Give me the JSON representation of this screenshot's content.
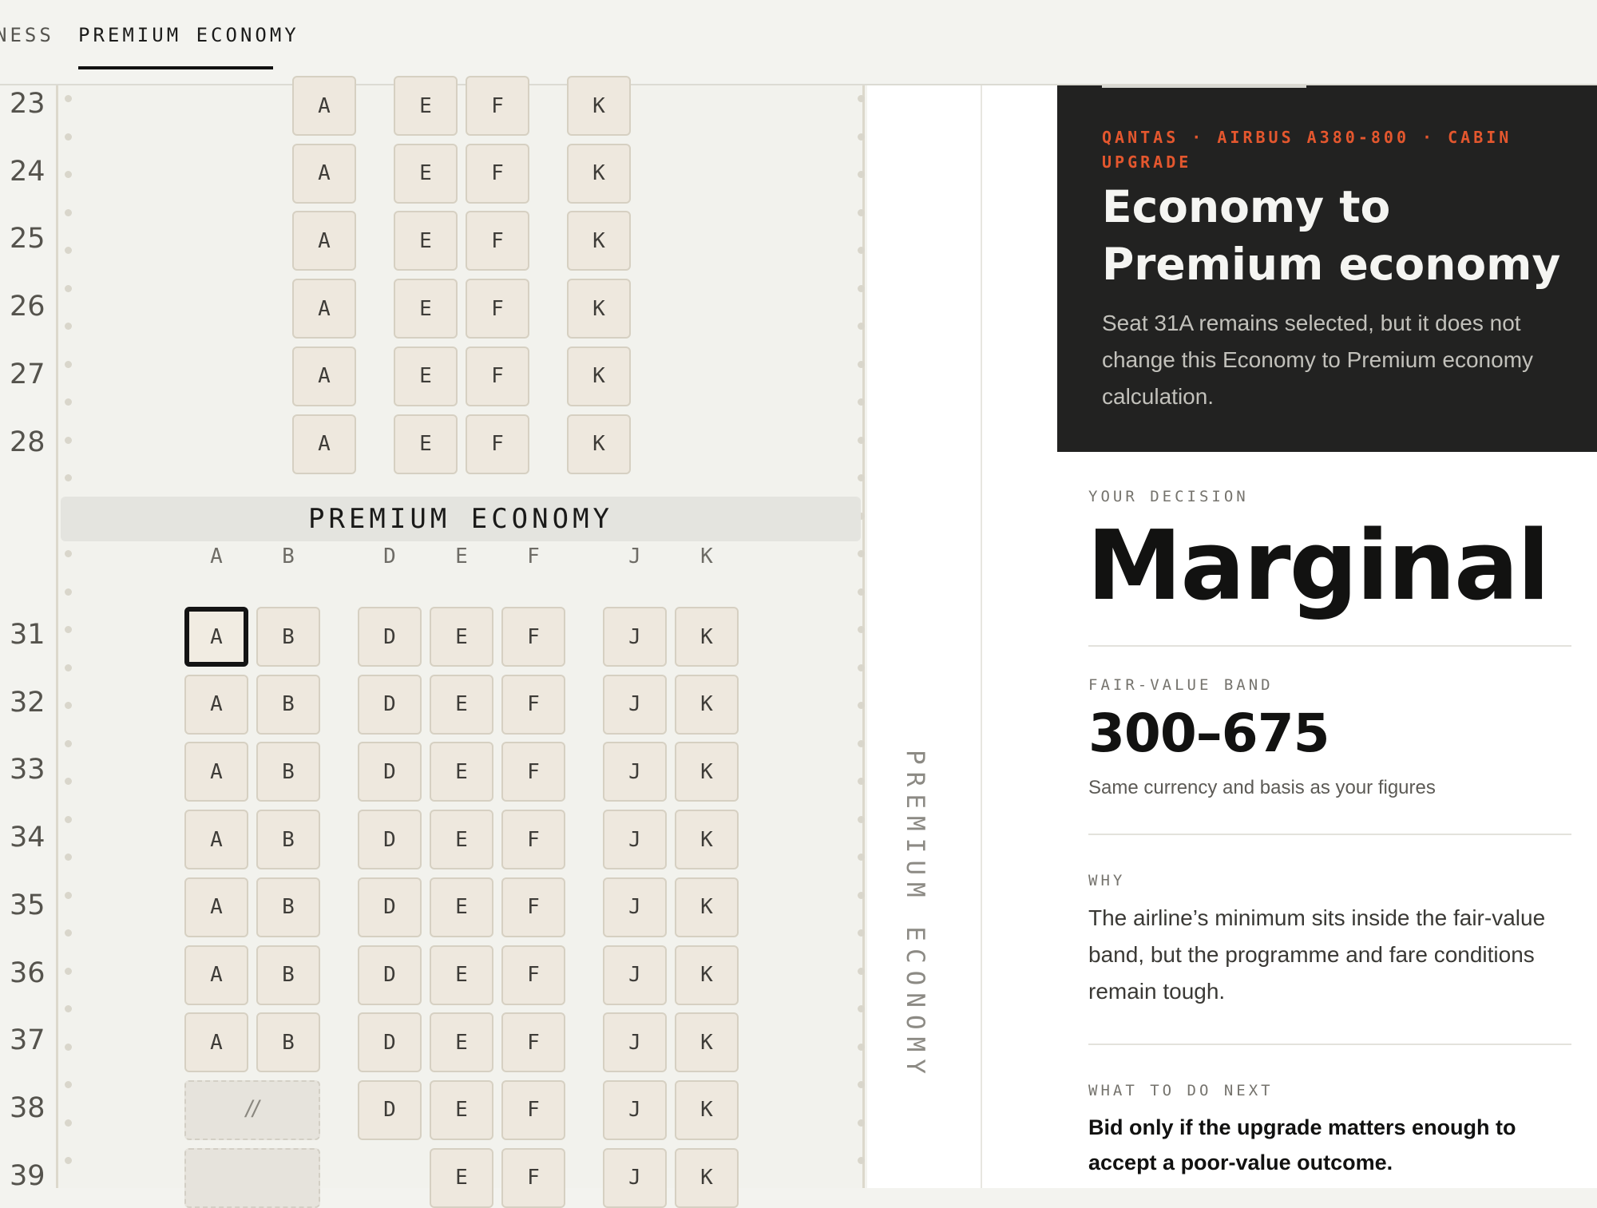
{
  "tabs": [
    {
      "label": "NESS",
      "active": false
    },
    {
      "label": "PREMIUM ECONOMY",
      "active": true
    }
  ],
  "seatmap": {
    "section_banner": "PREMIUM ECONOMY",
    "vertical_label": "PREMIUM ECONOMY",
    "selected_seat": "31A",
    "column_labels": [
      "A",
      "B",
      "D",
      "E",
      "F",
      "J",
      "K"
    ],
    "economy_rows": [
      {
        "row": "23",
        "seats": [
          "A",
          "E",
          "F",
          "K"
        ]
      },
      {
        "row": "24",
        "seats": [
          "A",
          "E",
          "F",
          "K"
        ]
      },
      {
        "row": "25",
        "seats": [
          "A",
          "E",
          "F",
          "K"
        ]
      },
      {
        "row": "26",
        "seats": [
          "A",
          "E",
          "F",
          "K"
        ]
      },
      {
        "row": "27",
        "seats": [
          "A",
          "E",
          "F",
          "K"
        ]
      },
      {
        "row": "28",
        "seats": [
          "A",
          "E",
          "F",
          "K"
        ]
      }
    ],
    "premium_rows": [
      {
        "row": "31",
        "seats": [
          "A",
          "B",
          "D",
          "E",
          "F",
          "J",
          "K"
        ]
      },
      {
        "row": "32",
        "seats": [
          "A",
          "B",
          "D",
          "E",
          "F",
          "J",
          "K"
        ]
      },
      {
        "row": "33",
        "seats": [
          "A",
          "B",
          "D",
          "E",
          "F",
          "J",
          "K"
        ]
      },
      {
        "row": "34",
        "seats": [
          "A",
          "B",
          "D",
          "E",
          "F",
          "J",
          "K"
        ]
      },
      {
        "row": "35",
        "seats": [
          "A",
          "B",
          "D",
          "E",
          "F",
          "J",
          "K"
        ]
      },
      {
        "row": "36",
        "seats": [
          "A",
          "B",
          "D",
          "E",
          "F",
          "J",
          "K"
        ]
      },
      {
        "row": "37",
        "seats": [
          "A",
          "B",
          "D",
          "E",
          "F",
          "J",
          "K"
        ]
      },
      {
        "row": "38",
        "seats": [
          "D",
          "E",
          "F",
          "J",
          "K"
        ],
        "blocked": "AB",
        "blocked_mark": "//"
      },
      {
        "row": "39",
        "seats": [
          "E",
          "F",
          "J",
          "K"
        ],
        "blocked": "AB",
        "blocked_mark": ""
      }
    ]
  },
  "card": {
    "eyebrow": "QANTAS · AIRBUS A380-800 · CABIN UPGRADE",
    "title": "Economy to Premium economy",
    "text": "Seat 31A remains selected, but it does not change this Economy to Premium economy calculation.",
    "accent_color": "#e4572e"
  },
  "decision": {
    "eyebrow": "YOUR DECISION",
    "value": "Marginal"
  },
  "band": {
    "eyebrow": "FAIR-VALUE BAND",
    "value": "300–675",
    "note": "Same currency and basis as your figures"
  },
  "why": {
    "eyebrow": "WHY",
    "text": "The airline’s minimum sits inside the fair-value band, but the programme and fare conditions remain tough."
  },
  "next": {
    "eyebrow": "WHAT TO DO NEXT",
    "text": "Bid only if the upgrade matters enough to accept a poor-value outcome."
  }
}
